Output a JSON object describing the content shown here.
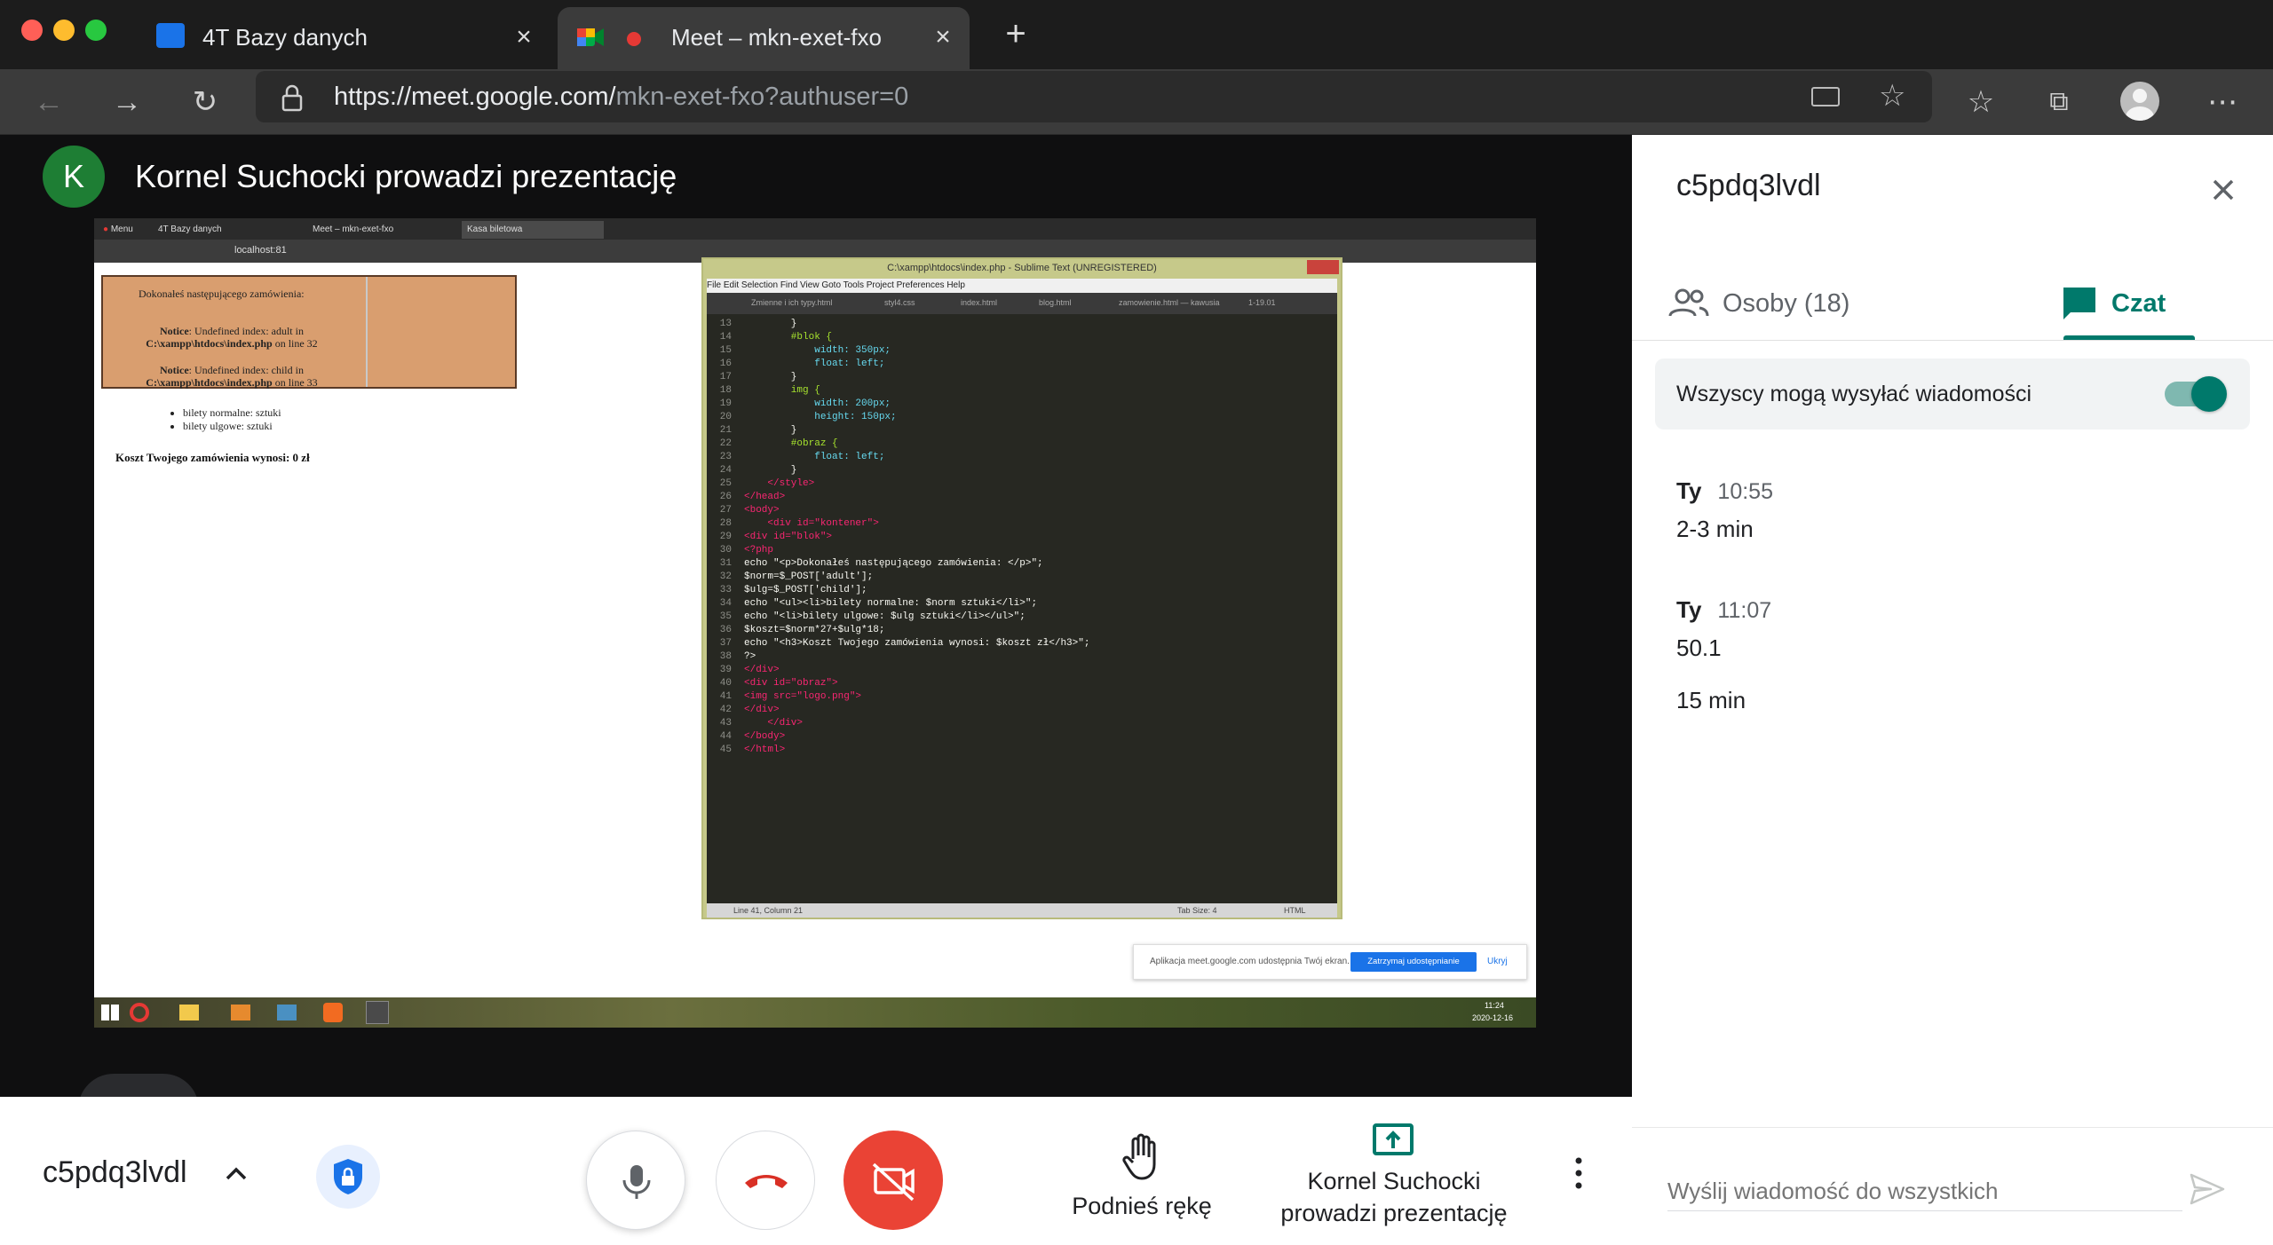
{
  "browser": {
    "tabs": [
      {
        "title": "4T Bazy danych"
      },
      {
        "title": "Meet – mkn-exet-fxo"
      }
    ],
    "url_host": "https://meet.google.com/",
    "url_path": "mkn-exet-fxo?authuser=0"
  },
  "meet": {
    "presenter_initial": "K",
    "presenter_banner": "Kornel Suchocki prowadzi prezentację",
    "meeting_code": "c5pdq3lvdl",
    "raise_hand_label": "Podnieś rękę",
    "presenting_label_line1": "Kornel Suchocki",
    "presenting_label_line2": "prowadzi prezentację"
  },
  "shared_screen": {
    "tabs": [
      "Menu",
      "4T Bazy danych",
      "Meet – mkn-exet-fxo",
      "Kasa biletowa"
    ],
    "address": "localhost:81",
    "page": {
      "heading": "Dokonałeś następującego zamówienia:",
      "notice1_bold": "Notice",
      "notice1_text": ": Undefined index: adult in",
      "notice1_path": "C:\\xampp\\htdocs\\index.php",
      "notice1_line": " on line 32",
      "notice2_bold": "Notice",
      "notice2_text": ": Undefined index: child in",
      "notice2_path": "C:\\xampp\\htdocs\\index.php",
      "notice2_line": " on line 33",
      "list": [
        "bilety normalne: sztuki",
        "bilety ulgowe: sztuki"
      ],
      "total": "Koszt Twojego zamówienia wynosi: 0 zł"
    },
    "sublime": {
      "title": "C:\\xampp\\htdocs\\index.php - Sublime Text (UNREGISTERED)",
      "menu": "File   Edit   Selection   Find   View   Goto   Tools   Project   Preferences   Help",
      "tabs": [
        "Zmienne i ich typy.html",
        "styl4.css",
        "index.html",
        "blog.html",
        "zamowienie.html — kawusia",
        "1-19.01"
      ],
      "status_left": "Line 41, Column 21",
      "status_mid": "Tab Size: 4",
      "status_right": "HTML",
      "code": [
        {
          "n": "13",
          "t": "        }"
        },
        {
          "n": "14",
          "t": "        #blok {"
        },
        {
          "n": "15",
          "t": "            width: 350px;"
        },
        {
          "n": "16",
          "t": "            float: left;"
        },
        {
          "n": "17",
          "t": "        }"
        },
        {
          "n": "18",
          "t": "        img {"
        },
        {
          "n": "19",
          "t": "            width: 200px;"
        },
        {
          "n": "20",
          "t": "            height: 150px;"
        },
        {
          "n": "21",
          "t": "        }"
        },
        {
          "n": "22",
          "t": "        #obraz {"
        },
        {
          "n": "23",
          "t": "            float: left;"
        },
        {
          "n": "24",
          "t": "        }"
        },
        {
          "n": "25",
          "t": "    </style>"
        },
        {
          "n": "26",
          "t": "</head>"
        },
        {
          "n": "27",
          "t": "<body>"
        },
        {
          "n": "28",
          "t": "    <div id=\"kontener\">"
        },
        {
          "n": "29",
          "t": "<div id=\"blok\">"
        },
        {
          "n": "30",
          "t": "<?php"
        },
        {
          "n": "31",
          "t": "echo \"<p>Dokonałeś następującego zamówienia: </p>\";"
        },
        {
          "n": "32",
          "t": "$norm=$_POST['adult'];"
        },
        {
          "n": "33",
          "t": "$ulg=$_POST['child'];"
        },
        {
          "n": "34",
          "t": "echo \"<ul><li>bilety normalne: $norm sztuki</li>\";"
        },
        {
          "n": "35",
          "t": "echo \"<li>bilety ulgowe: $ulg sztuki</li></ul>\";"
        },
        {
          "n": "36",
          "t": "$koszt=$norm*27+$ulg*18;"
        },
        {
          "n": "37",
          "t": "echo \"<h3>Koszt Twojego zamówienia wynosi: $koszt zł</h3>\";"
        },
        {
          "n": "38",
          "t": "?>"
        },
        {
          "n": "39",
          "t": "</div>"
        },
        {
          "n": "40",
          "t": "<div id=\"obraz\">"
        },
        {
          "n": "41",
          "t": "<img src=\"logo.png\">"
        },
        {
          "n": "42",
          "t": "</div>"
        },
        {
          "n": "43",
          "t": "    </div>"
        },
        {
          "n": "44",
          "t": "</body>"
        },
        {
          "n": "45",
          "t": "</html>"
        }
      ]
    },
    "share_notice": "Aplikacja meet.google.com udostępnia Twój ekran.",
    "stop_share": "Zatrzymaj udostępnianie",
    "hide": "Ukryj",
    "clock_time": "11:24",
    "clock_date": "2020-12-16"
  },
  "panel": {
    "title": "c5pdq3lvdl",
    "tab_people": "Osoby (18)",
    "tab_chat": "Czat",
    "toggle_label": "Wszyscy mogą wysyłać wiadomości",
    "messages": [
      {
        "name": "Ty",
        "time": "10:55",
        "texts": [
          "2-3 min"
        ]
      },
      {
        "name": "Ty",
        "time": "11:07",
        "texts": [
          "50.1",
          "15 min"
        ]
      }
    ],
    "compose_placeholder": "Wyślij wiadomość do wszystkich"
  },
  "colors": {
    "meet_green": "#00796b",
    "end_call_red": "#d93025",
    "cam_off_red": "#ea4335"
  }
}
